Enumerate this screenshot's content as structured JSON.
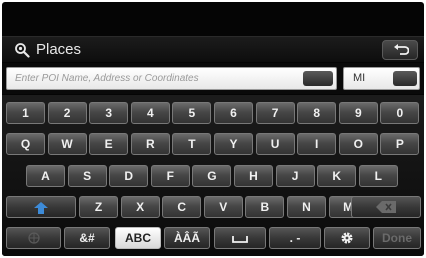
{
  "header": {
    "title": "Places",
    "icon": "search-icon",
    "back_icon": "back-arrow-icon"
  },
  "search": {
    "placeholder": "Enter POI Name, Address or Coordinates",
    "unit_value": "MI"
  },
  "keyboard": {
    "row1": [
      "1",
      "2",
      "3",
      "4",
      "5",
      "6",
      "7",
      "8",
      "9",
      "0"
    ],
    "row2": [
      "Q",
      "W",
      "E",
      "R",
      "T",
      "Y",
      "U",
      "I",
      "O",
      "P"
    ],
    "row3": [
      "A",
      "S",
      "D",
      "F",
      "G",
      "H",
      "J",
      "K",
      "L"
    ],
    "row4": [
      "Z",
      "X",
      "C",
      "V",
      "B",
      "N",
      "M"
    ],
    "symbols_label": "&#",
    "abc_label": "ABC",
    "accents_label": "ÀÂÃ",
    "dash_label": ". -",
    "done_label": "Done",
    "shift_icon": "shift-arrow-icon",
    "backspace_icon": "backspace-icon",
    "space_icon": "space-icon",
    "settings_icon": "gear-icon",
    "globe_icon": "globe-icon"
  }
}
